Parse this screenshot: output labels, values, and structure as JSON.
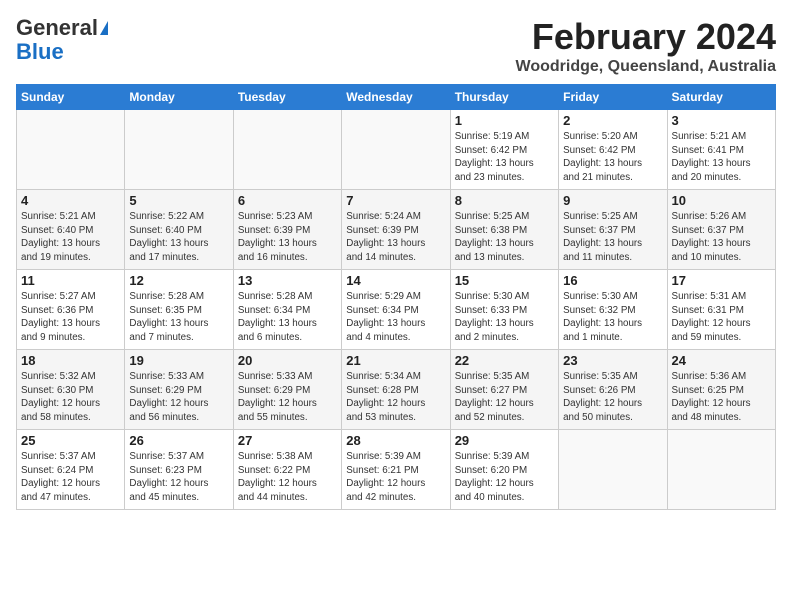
{
  "header": {
    "logo_general": "General",
    "logo_blue": "Blue",
    "title": "February 2024",
    "location": "Woodridge, Queensland, Australia"
  },
  "weekdays": [
    "Sunday",
    "Monday",
    "Tuesday",
    "Wednesday",
    "Thursday",
    "Friday",
    "Saturday"
  ],
  "weeks": [
    {
      "alt": false,
      "days": [
        {
          "num": "",
          "info": ""
        },
        {
          "num": "",
          "info": ""
        },
        {
          "num": "",
          "info": ""
        },
        {
          "num": "",
          "info": ""
        },
        {
          "num": "1",
          "info": "Sunrise: 5:19 AM\nSunset: 6:42 PM\nDaylight: 13 hours\nand 23 minutes."
        },
        {
          "num": "2",
          "info": "Sunrise: 5:20 AM\nSunset: 6:42 PM\nDaylight: 13 hours\nand 21 minutes."
        },
        {
          "num": "3",
          "info": "Sunrise: 5:21 AM\nSunset: 6:41 PM\nDaylight: 13 hours\nand 20 minutes."
        }
      ]
    },
    {
      "alt": true,
      "days": [
        {
          "num": "4",
          "info": "Sunrise: 5:21 AM\nSunset: 6:40 PM\nDaylight: 13 hours\nand 19 minutes."
        },
        {
          "num": "5",
          "info": "Sunrise: 5:22 AM\nSunset: 6:40 PM\nDaylight: 13 hours\nand 17 minutes."
        },
        {
          "num": "6",
          "info": "Sunrise: 5:23 AM\nSunset: 6:39 PM\nDaylight: 13 hours\nand 16 minutes."
        },
        {
          "num": "7",
          "info": "Sunrise: 5:24 AM\nSunset: 6:39 PM\nDaylight: 13 hours\nand 14 minutes."
        },
        {
          "num": "8",
          "info": "Sunrise: 5:25 AM\nSunset: 6:38 PM\nDaylight: 13 hours\nand 13 minutes."
        },
        {
          "num": "9",
          "info": "Sunrise: 5:25 AM\nSunset: 6:37 PM\nDaylight: 13 hours\nand 11 minutes."
        },
        {
          "num": "10",
          "info": "Sunrise: 5:26 AM\nSunset: 6:37 PM\nDaylight: 13 hours\nand 10 minutes."
        }
      ]
    },
    {
      "alt": false,
      "days": [
        {
          "num": "11",
          "info": "Sunrise: 5:27 AM\nSunset: 6:36 PM\nDaylight: 13 hours\nand 9 minutes."
        },
        {
          "num": "12",
          "info": "Sunrise: 5:28 AM\nSunset: 6:35 PM\nDaylight: 13 hours\nand 7 minutes."
        },
        {
          "num": "13",
          "info": "Sunrise: 5:28 AM\nSunset: 6:34 PM\nDaylight: 13 hours\nand 6 minutes."
        },
        {
          "num": "14",
          "info": "Sunrise: 5:29 AM\nSunset: 6:34 PM\nDaylight: 13 hours\nand 4 minutes."
        },
        {
          "num": "15",
          "info": "Sunrise: 5:30 AM\nSunset: 6:33 PM\nDaylight: 13 hours\nand 2 minutes."
        },
        {
          "num": "16",
          "info": "Sunrise: 5:30 AM\nSunset: 6:32 PM\nDaylight: 13 hours\nand 1 minute."
        },
        {
          "num": "17",
          "info": "Sunrise: 5:31 AM\nSunset: 6:31 PM\nDaylight: 12 hours\nand 59 minutes."
        }
      ]
    },
    {
      "alt": true,
      "days": [
        {
          "num": "18",
          "info": "Sunrise: 5:32 AM\nSunset: 6:30 PM\nDaylight: 12 hours\nand 58 minutes."
        },
        {
          "num": "19",
          "info": "Sunrise: 5:33 AM\nSunset: 6:29 PM\nDaylight: 12 hours\nand 56 minutes."
        },
        {
          "num": "20",
          "info": "Sunrise: 5:33 AM\nSunset: 6:29 PM\nDaylight: 12 hours\nand 55 minutes."
        },
        {
          "num": "21",
          "info": "Sunrise: 5:34 AM\nSunset: 6:28 PM\nDaylight: 12 hours\nand 53 minutes."
        },
        {
          "num": "22",
          "info": "Sunrise: 5:35 AM\nSunset: 6:27 PM\nDaylight: 12 hours\nand 52 minutes."
        },
        {
          "num": "23",
          "info": "Sunrise: 5:35 AM\nSunset: 6:26 PM\nDaylight: 12 hours\nand 50 minutes."
        },
        {
          "num": "24",
          "info": "Sunrise: 5:36 AM\nSunset: 6:25 PM\nDaylight: 12 hours\nand 48 minutes."
        }
      ]
    },
    {
      "alt": false,
      "days": [
        {
          "num": "25",
          "info": "Sunrise: 5:37 AM\nSunset: 6:24 PM\nDaylight: 12 hours\nand 47 minutes."
        },
        {
          "num": "26",
          "info": "Sunrise: 5:37 AM\nSunset: 6:23 PM\nDaylight: 12 hours\nand 45 minutes."
        },
        {
          "num": "27",
          "info": "Sunrise: 5:38 AM\nSunset: 6:22 PM\nDaylight: 12 hours\nand 44 minutes."
        },
        {
          "num": "28",
          "info": "Sunrise: 5:39 AM\nSunset: 6:21 PM\nDaylight: 12 hours\nand 42 minutes."
        },
        {
          "num": "29",
          "info": "Sunrise: 5:39 AM\nSunset: 6:20 PM\nDaylight: 12 hours\nand 40 minutes."
        },
        {
          "num": "",
          "info": ""
        },
        {
          "num": "",
          "info": ""
        }
      ]
    }
  ]
}
